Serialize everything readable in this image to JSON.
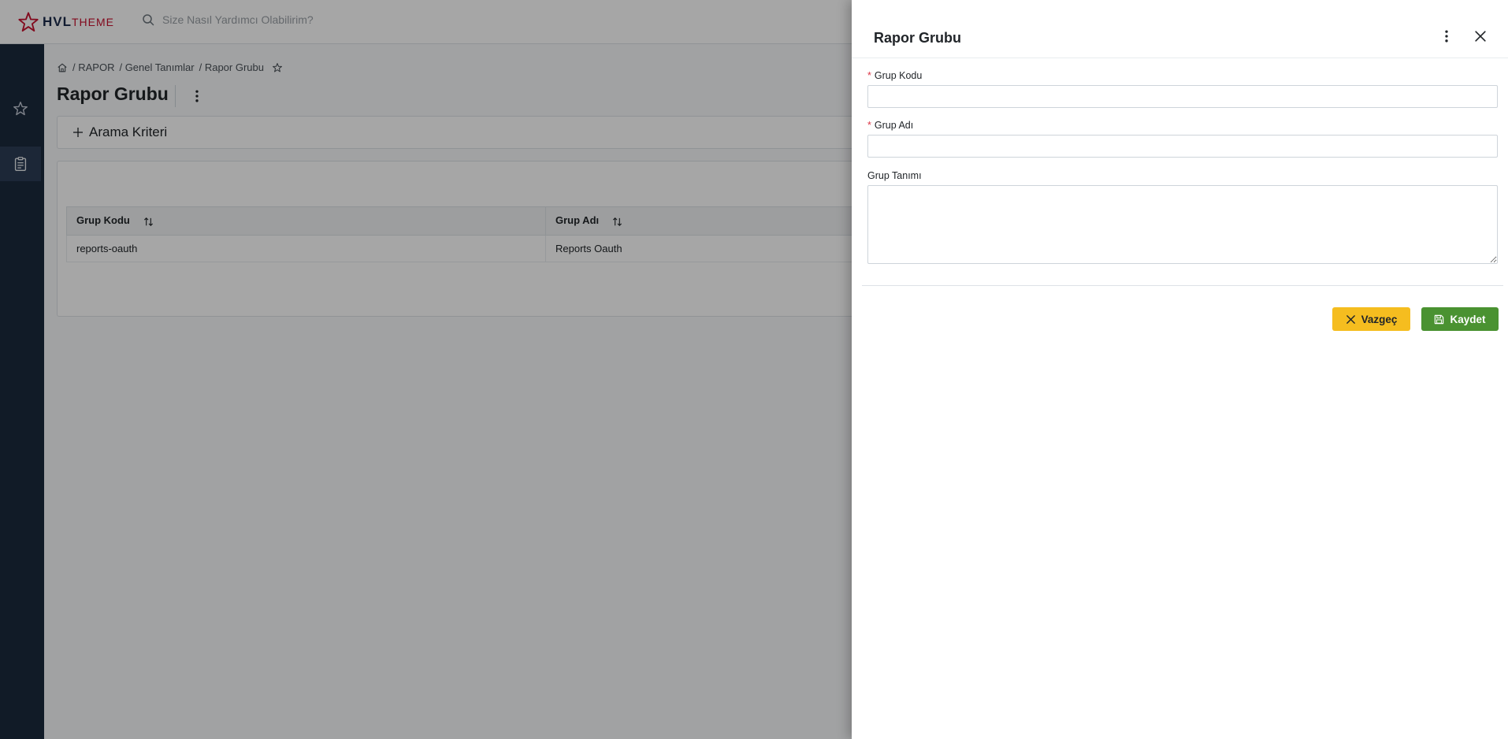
{
  "app": {
    "logo_main": "HVL",
    "logo_suffix": "THEME",
    "search_placeholder": "Size Nasıl Yardımcı Olabilirim?"
  },
  "breadcrumb": {
    "items": [
      "/ RAPOR",
      "/ Genel Tanımlar",
      "/ Rapor Grubu"
    ]
  },
  "page": {
    "title": "Rapor Grubu",
    "criteria_label": "Arama Kriteri"
  },
  "grid": {
    "columns": [
      "Grup Kodu",
      "Grup Adı"
    ],
    "rows": [
      [
        "reports-oauth",
        "Reports Oauth"
      ]
    ]
  },
  "drawer": {
    "title": "Rapor Grubu",
    "fields": {
      "code_label": "Grup Kodu",
      "code_value": "",
      "name_label": "Grup Adı",
      "name_value": "",
      "desc_label": "Grup Tanımı",
      "desc_value": ""
    },
    "cancel_label": "Vazgeç",
    "save_label": "Kaydet"
  },
  "colors": {
    "sidebar": "#1b2a3d",
    "brand_red": "#c8102e",
    "cancel": "#f5bd1f",
    "save": "#4a9231",
    "required": "#dc3545"
  },
  "icons": [
    "star-logo-icon",
    "search-icon",
    "favorite-star-icon",
    "clipboard-icon",
    "home-icon",
    "bookmark-star-icon",
    "more-vertical-icon",
    "plus-icon",
    "sort-icon",
    "close-icon",
    "save-icon"
  ]
}
